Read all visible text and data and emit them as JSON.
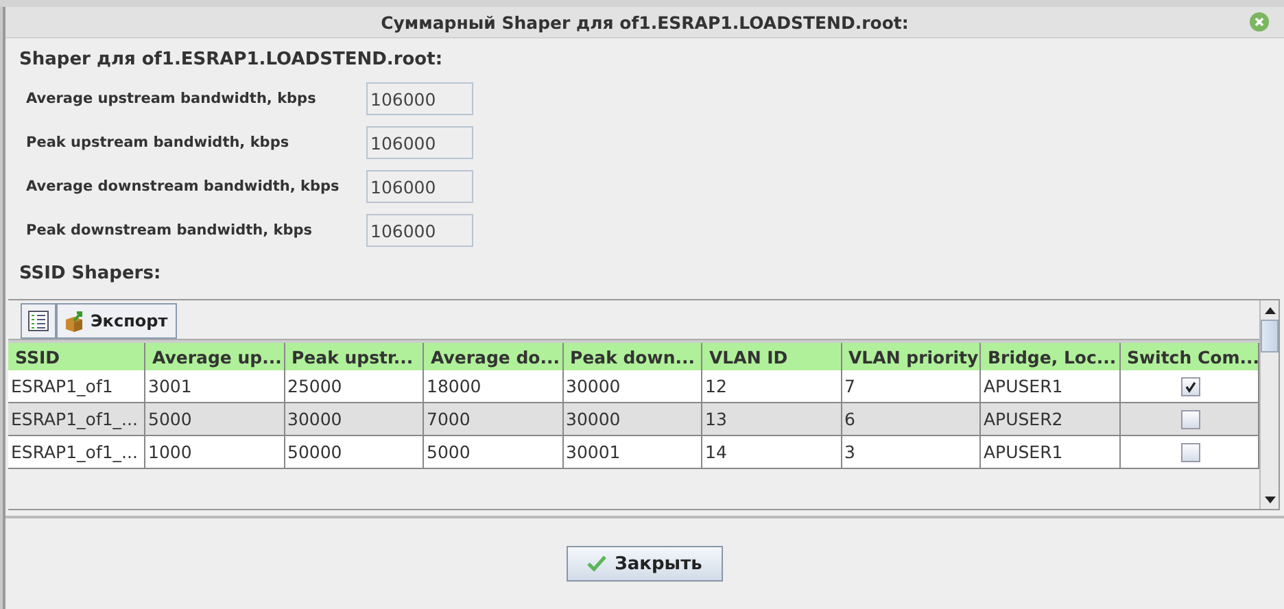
{
  "window": {
    "title": "Суммарный Shaper для of1.ESRAP1.LOADSTEND.root:"
  },
  "shaper": {
    "heading": "Shaper для of1.ESRAP1.LOADSTEND.root:",
    "fields": [
      {
        "label": "Average upstream bandwidth, kbps",
        "value": "106000"
      },
      {
        "label": "Peak upstream bandwidth, kbps",
        "value": "106000"
      },
      {
        "label": "Average downstream bandwidth, kbps",
        "value": "106000"
      },
      {
        "label": "Peak downstream bandwidth, kbps",
        "value": "106000"
      }
    ]
  },
  "ssid_section": {
    "heading": "SSID Shapers:"
  },
  "toolbar": {
    "export_label": "Экспорт"
  },
  "table": {
    "columns": [
      "SSID",
      "Average up...",
      "Peak upstr...",
      "Average do...",
      "Peak down...",
      "VLAN ID",
      "VLAN priority",
      "Bridge, Loc...",
      "Switch Com..."
    ],
    "rows": [
      {
        "cells": [
          "ESRAP1_of1",
          "3001",
          "25000",
          "18000",
          "30000",
          "12",
          "7",
          "APUSER1"
        ],
        "checked": true,
        "selected": false
      },
      {
        "cells": [
          "ESRAP1_of1_...",
          "5000",
          "30000",
          "7000",
          "30000",
          "13",
          "6",
          "APUSER2"
        ],
        "checked": false,
        "selected": true
      },
      {
        "cells": [
          "ESRAP1_of1_...",
          "1000",
          "50000",
          "5000",
          "30001",
          "14",
          "3",
          "APUSER1"
        ],
        "checked": false,
        "selected": false
      }
    ]
  },
  "buttons": [
    {
      "label": "Закрыть"
    }
  ]
}
